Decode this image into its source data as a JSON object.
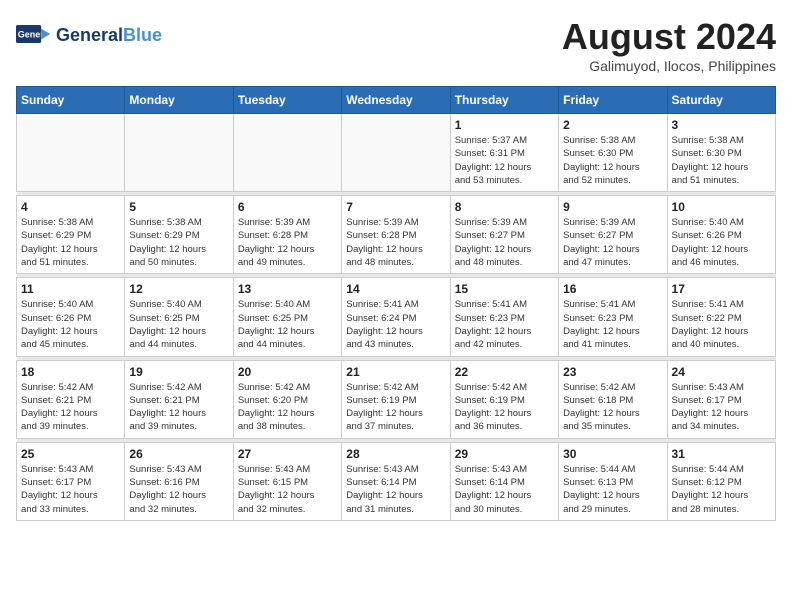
{
  "logo": {
    "line1": "General",
    "line2": "Blue",
    "tagline": ""
  },
  "title": {
    "month_year": "August 2024",
    "location": "Galimuyod, Ilocos, Philippines"
  },
  "weekdays": [
    "Sunday",
    "Monday",
    "Tuesday",
    "Wednesday",
    "Thursday",
    "Friday",
    "Saturday"
  ],
  "weeks": [
    [
      {
        "day": "",
        "info": ""
      },
      {
        "day": "",
        "info": ""
      },
      {
        "day": "",
        "info": ""
      },
      {
        "day": "",
        "info": ""
      },
      {
        "day": "1",
        "info": "Sunrise: 5:37 AM\nSunset: 6:31 PM\nDaylight: 12 hours\nand 53 minutes."
      },
      {
        "day": "2",
        "info": "Sunrise: 5:38 AM\nSunset: 6:30 PM\nDaylight: 12 hours\nand 52 minutes."
      },
      {
        "day": "3",
        "info": "Sunrise: 5:38 AM\nSunset: 6:30 PM\nDaylight: 12 hours\nand 51 minutes."
      }
    ],
    [
      {
        "day": "4",
        "info": "Sunrise: 5:38 AM\nSunset: 6:29 PM\nDaylight: 12 hours\nand 51 minutes."
      },
      {
        "day": "5",
        "info": "Sunrise: 5:38 AM\nSunset: 6:29 PM\nDaylight: 12 hours\nand 50 minutes."
      },
      {
        "day": "6",
        "info": "Sunrise: 5:39 AM\nSunset: 6:28 PM\nDaylight: 12 hours\nand 49 minutes."
      },
      {
        "day": "7",
        "info": "Sunrise: 5:39 AM\nSunset: 6:28 PM\nDaylight: 12 hours\nand 48 minutes."
      },
      {
        "day": "8",
        "info": "Sunrise: 5:39 AM\nSunset: 6:27 PM\nDaylight: 12 hours\nand 48 minutes."
      },
      {
        "day": "9",
        "info": "Sunrise: 5:39 AM\nSunset: 6:27 PM\nDaylight: 12 hours\nand 47 minutes."
      },
      {
        "day": "10",
        "info": "Sunrise: 5:40 AM\nSunset: 6:26 PM\nDaylight: 12 hours\nand 46 minutes."
      }
    ],
    [
      {
        "day": "11",
        "info": "Sunrise: 5:40 AM\nSunset: 6:26 PM\nDaylight: 12 hours\nand 45 minutes."
      },
      {
        "day": "12",
        "info": "Sunrise: 5:40 AM\nSunset: 6:25 PM\nDaylight: 12 hours\nand 44 minutes."
      },
      {
        "day": "13",
        "info": "Sunrise: 5:40 AM\nSunset: 6:25 PM\nDaylight: 12 hours\nand 44 minutes."
      },
      {
        "day": "14",
        "info": "Sunrise: 5:41 AM\nSunset: 6:24 PM\nDaylight: 12 hours\nand 43 minutes."
      },
      {
        "day": "15",
        "info": "Sunrise: 5:41 AM\nSunset: 6:23 PM\nDaylight: 12 hours\nand 42 minutes."
      },
      {
        "day": "16",
        "info": "Sunrise: 5:41 AM\nSunset: 6:23 PM\nDaylight: 12 hours\nand 41 minutes."
      },
      {
        "day": "17",
        "info": "Sunrise: 5:41 AM\nSunset: 6:22 PM\nDaylight: 12 hours\nand 40 minutes."
      }
    ],
    [
      {
        "day": "18",
        "info": "Sunrise: 5:42 AM\nSunset: 6:21 PM\nDaylight: 12 hours\nand 39 minutes."
      },
      {
        "day": "19",
        "info": "Sunrise: 5:42 AM\nSunset: 6:21 PM\nDaylight: 12 hours\nand 39 minutes."
      },
      {
        "day": "20",
        "info": "Sunrise: 5:42 AM\nSunset: 6:20 PM\nDaylight: 12 hours\nand 38 minutes."
      },
      {
        "day": "21",
        "info": "Sunrise: 5:42 AM\nSunset: 6:19 PM\nDaylight: 12 hours\nand 37 minutes."
      },
      {
        "day": "22",
        "info": "Sunrise: 5:42 AM\nSunset: 6:19 PM\nDaylight: 12 hours\nand 36 minutes."
      },
      {
        "day": "23",
        "info": "Sunrise: 5:42 AM\nSunset: 6:18 PM\nDaylight: 12 hours\nand 35 minutes."
      },
      {
        "day": "24",
        "info": "Sunrise: 5:43 AM\nSunset: 6:17 PM\nDaylight: 12 hours\nand 34 minutes."
      }
    ],
    [
      {
        "day": "25",
        "info": "Sunrise: 5:43 AM\nSunset: 6:17 PM\nDaylight: 12 hours\nand 33 minutes."
      },
      {
        "day": "26",
        "info": "Sunrise: 5:43 AM\nSunset: 6:16 PM\nDaylight: 12 hours\nand 32 minutes."
      },
      {
        "day": "27",
        "info": "Sunrise: 5:43 AM\nSunset: 6:15 PM\nDaylight: 12 hours\nand 32 minutes."
      },
      {
        "day": "28",
        "info": "Sunrise: 5:43 AM\nSunset: 6:14 PM\nDaylight: 12 hours\nand 31 minutes."
      },
      {
        "day": "29",
        "info": "Sunrise: 5:43 AM\nSunset: 6:14 PM\nDaylight: 12 hours\nand 30 minutes."
      },
      {
        "day": "30",
        "info": "Sunrise: 5:44 AM\nSunset: 6:13 PM\nDaylight: 12 hours\nand 29 minutes."
      },
      {
        "day": "31",
        "info": "Sunrise: 5:44 AM\nSunset: 6:12 PM\nDaylight: 12 hours\nand 28 minutes."
      }
    ]
  ]
}
